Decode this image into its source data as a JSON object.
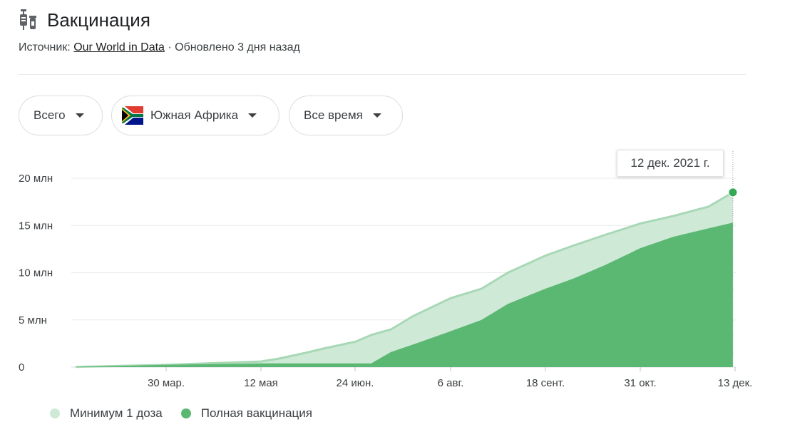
{
  "header": {
    "title": "Вакцинация",
    "source_prefix": "Источник:",
    "source_link": "Our World in Data",
    "updated": "· Обновлено 3 дня назад",
    "icon": "vaccine-icon"
  },
  "filters": {
    "metric": "Всего",
    "region": "Южная Африка",
    "period": "Все время"
  },
  "tooltip": {
    "date": "12 дек. 2021 г."
  },
  "colors": {
    "at_least_one": "#cfe9d7",
    "at_least_one_line": "#a8d8b5",
    "fully": "#5bb872",
    "grid": "#e8eaed"
  },
  "chart_data": {
    "type": "area",
    "title": "",
    "xlabel": "",
    "ylabel": "",
    "ylim": [
      0,
      20
    ],
    "y_unit": "млн",
    "y_ticks": [
      "0",
      "5 млн",
      "10 млн",
      "15 млн",
      "20 млн"
    ],
    "x_ticks": [
      "30 мар.",
      "12 мая",
      "24 июн.",
      "6 авг.",
      "18 сент.",
      "31 окт.",
      "13 дек."
    ],
    "x": [
      "2021-02-17",
      "2021-03-30",
      "2021-05-12",
      "2021-05-20",
      "2021-06-01",
      "2021-06-10",
      "2021-06-24",
      "2021-07-01",
      "2021-07-10",
      "2021-07-20",
      "2021-08-06",
      "2021-08-20",
      "2021-09-01",
      "2021-09-18",
      "2021-10-01",
      "2021-10-15",
      "2021-10-31",
      "2021-11-15",
      "2021-12-01",
      "2021-12-12"
    ],
    "series": [
      {
        "name": "Минимум 1 доза",
        "values": [
          0.02,
          0.25,
          0.6,
          0.9,
          1.5,
          2.0,
          2.7,
          3.4,
          4.0,
          5.4,
          7.3,
          8.3,
          10.0,
          11.8,
          12.9,
          14.0,
          15.2,
          16.0,
          17.0,
          18.5
        ]
      },
      {
        "name": "Полная вакцинация",
        "values": [
          0.02,
          0.25,
          0.4,
          0.4,
          0.4,
          0.4,
          0.4,
          0.4,
          1.6,
          2.4,
          3.8,
          5.0,
          6.7,
          8.3,
          9.4,
          10.8,
          12.6,
          13.8,
          14.7,
          15.3
        ]
      }
    ],
    "legend": "bottom-left",
    "grid": true
  }
}
